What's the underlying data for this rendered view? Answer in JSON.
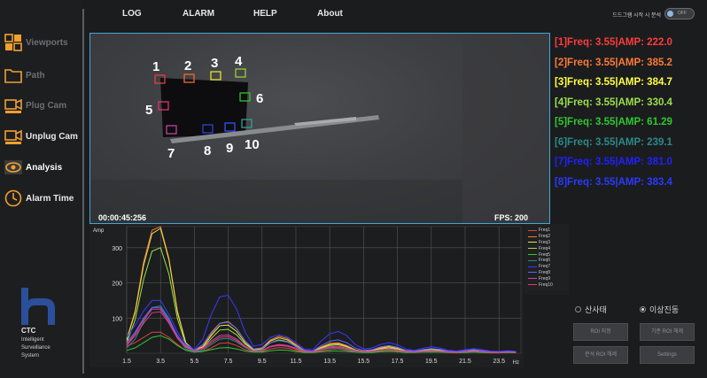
{
  "sidebar": {
    "items": [
      {
        "label": "Viewports",
        "color": "#f0a030"
      },
      {
        "label": "Path",
        "color": "#f0a030"
      },
      {
        "label": "Plug Cam",
        "color": "#f0a030"
      },
      {
        "label": "Unplug Cam",
        "color": "#f0a030"
      },
      {
        "label": "Analysis",
        "color": "#f0a030"
      },
      {
        "label": "Alarm Time",
        "color": "#f0a030"
      }
    ],
    "logo": {
      "name": "CTC",
      "tagline": [
        "Intelligent",
        "Surveillance",
        "System"
      ],
      "color": "#2b4f9a"
    }
  },
  "menu": {
    "items": [
      "LOG",
      "ALARM",
      "HELP",
      "About"
    ],
    "toggle_label": "드드그램 시작 시 분석",
    "toggle_state": "OFF"
  },
  "video": {
    "timecode": "00:00:45:256",
    "fps": "FPS: 200",
    "rois": [
      {
        "label": "1",
        "color": "#e04040"
      },
      {
        "label": "2",
        "color": "#f06a30"
      },
      {
        "label": "3",
        "color": "#e8e030"
      },
      {
        "label": "4",
        "color": "#8ed03a"
      },
      {
        "label": "5",
        "color": "#e03070"
      },
      {
        "label": "6",
        "color": "#30c030"
      },
      {
        "label": "7",
        "color": "#c040a0"
      },
      {
        "label": "8",
        "color": "#3040d0"
      },
      {
        "label": "9",
        "color": "#3050ff"
      },
      {
        "label": "10",
        "color": "#30a090"
      }
    ]
  },
  "readouts": [
    {
      "text": "[1]Freq: 3.55|AMP: 222.0",
      "color": "#ff3b3b"
    },
    {
      "text": "[2]Freq: 3.55|AMP: 385.2",
      "color": "#ff7a3a"
    },
    {
      "text": "[3]Freq: 3.55|AMP: 384.7",
      "color": "#ffff40"
    },
    {
      "text": "[4]Freq: 3.55|AMP: 330.4",
      "color": "#9be04a"
    },
    {
      "text": "[5]Freq: 3.55|AMP: 61.29",
      "color": "#2fc82f"
    },
    {
      "text": "[6]Freq: 3.55|AMP: 239.1",
      "color": "#2a8a8a"
    },
    {
      "text": "[7]Freq: 3.55|AMP: 381.0",
      "color": "#2020ff"
    },
    {
      "text": "[8]Freq: 3.55|AMP: 383.4",
      "color": "#2a3aff"
    }
  ],
  "chart_data": {
    "type": "line",
    "ylabel": "Amp",
    "xlabel": "Hz",
    "xlim": [
      1.5,
      24.8
    ],
    "ylim": [
      0,
      360
    ],
    "x_ticks": [
      "1.5",
      "3.5",
      "5.5",
      "7.5",
      "9.5",
      "11.5",
      "13.5",
      "15.5",
      "17.5",
      "19.5",
      "21.5",
      "23.5"
    ],
    "x_tick_values": [
      1.5,
      3.5,
      5.5,
      7.5,
      9.5,
      11.5,
      13.5,
      15.5,
      17.5,
      19.5,
      21.5,
      23.5
    ],
    "y_ticks": [
      "100",
      "200",
      "300"
    ],
    "y_tick_values": [
      100,
      200,
      300
    ],
    "x": [
      1.5,
      2.0,
      2.5,
      3.0,
      3.5,
      4.0,
      4.5,
      5.0,
      5.5,
      6.0,
      6.5,
      7.0,
      7.5,
      8.0,
      8.5,
      9.0,
      9.5,
      10.0,
      10.5,
      11.0,
      11.5,
      12.0,
      12.5,
      13.0,
      13.5,
      14.0,
      14.5,
      15.0,
      15.5,
      16.0,
      16.5,
      17.0,
      17.5,
      18.0,
      18.5,
      19.0,
      19.5,
      20.0,
      20.5,
      21.0,
      21.5,
      22.0,
      22.5,
      23.0,
      23.5,
      24.0,
      24.5
    ],
    "series": [
      {
        "name": "Freq1",
        "color": "#e04040",
        "values": [
          20,
          30,
          45,
          60,
          60,
          45,
          25,
          8,
          3,
          5,
          15,
          28,
          30,
          22,
          10,
          4,
          5,
          12,
          16,
          14,
          8,
          3,
          2,
          6,
          10,
          12,
          8,
          4,
          2,
          3,
          6,
          8,
          6,
          3,
          2,
          4,
          5,
          4,
          2,
          2,
          3,
          4,
          3,
          2,
          2,
          3,
          2
        ]
      },
      {
        "name": "Freq2",
        "color": "#f07a3a",
        "values": [
          40,
          120,
          260,
          350,
          360,
          270,
          120,
          30,
          8,
          20,
          55,
          85,
          90,
          70,
          35,
          12,
          15,
          38,
          48,
          42,
          25,
          8,
          6,
          18,
          28,
          30,
          22,
          10,
          5,
          8,
          16,
          20,
          15,
          7,
          5,
          9,
          12,
          10,
          5,
          4,
          7,
          9,
          7,
          4,
          3,
          5,
          4
        ]
      },
      {
        "name": "Freq3",
        "color": "#e8e048",
        "values": [
          38,
          115,
          250,
          340,
          355,
          265,
          115,
          28,
          8,
          18,
          50,
          78,
          80,
          62,
          30,
          10,
          14,
          35,
          44,
          38,
          22,
          7,
          5,
          16,
          25,
          27,
          20,
          9,
          5,
          7,
          14,
          18,
          13,
          6,
          4,
          8,
          11,
          9,
          5,
          4,
          6,
          8,
          6,
          4,
          3,
          4,
          3
        ]
      },
      {
        "name": "Freq4",
        "color": "#9be04a",
        "values": [
          30,
          95,
          210,
          290,
          300,
          225,
          98,
          24,
          7,
          15,
          42,
          66,
          68,
          52,
          26,
          9,
          12,
          30,
          38,
          33,
          19,
          6,
          5,
          14,
          22,
          24,
          18,
          8,
          4,
          6,
          12,
          15,
          11,
          5,
          4,
          7,
          9,
          8,
          4,
          3,
          5,
          7,
          5,
          3,
          3,
          4,
          3
        ]
      },
      {
        "name": "Freq5",
        "color": "#2fc82f",
        "values": [
          8,
          15,
          30,
          45,
          50,
          40,
          22,
          8,
          3,
          5,
          10,
          15,
          16,
          12,
          6,
          3,
          3,
          7,
          9,
          8,
          5,
          2,
          2,
          4,
          6,
          6,
          5,
          3,
          2,
          2,
          4,
          5,
          4,
          2,
          2,
          3,
          3,
          3,
          2,
          1,
          2,
          3,
          2,
          1,
          1,
          2,
          1
        ]
      },
      {
        "name": "Freq6",
        "color": "#2a8a8a",
        "values": [
          15,
          40,
          90,
          130,
          135,
          100,
          45,
          12,
          4,
          8,
          25,
          40,
          42,
          32,
          16,
          5,
          7,
          18,
          22,
          20,
          12,
          4,
          3,
          9,
          14,
          15,
          11,
          5,
          3,
          4,
          8,
          10,
          8,
          4,
          3,
          5,
          6,
          5,
          3,
          2,
          4,
          5,
          4,
          2,
          2,
          3,
          2
        ]
      },
      {
        "name": "Freq7",
        "color": "#3a3aff",
        "values": [
          45,
          80,
          120,
          150,
          150,
          110,
          60,
          25,
          10,
          40,
          110,
          160,
          165,
          125,
          60,
          20,
          25,
          45,
          52,
          46,
          30,
          12,
          10,
          35,
          55,
          62,
          50,
          25,
          12,
          15,
          25,
          30,
          24,
          12,
          8,
          14,
          18,
          15,
          8,
          6,
          10,
          13,
          10,
          6,
          5,
          7,
          5
        ]
      },
      {
        "name": "Freq8",
        "color": "#5a6aff",
        "values": [
          30,
          60,
          100,
          130,
          130,
          95,
          50,
          20,
          8,
          25,
          60,
          85,
          88,
          70,
          35,
          12,
          15,
          30,
          36,
          32,
          20,
          8,
          6,
          22,
          34,
          38,
          30,
          15,
          8,
          10,
          18,
          22,
          17,
          8,
          6,
          10,
          13,
          11,
          6,
          4,
          7,
          10,
          7,
          4,
          3,
          5,
          4
        ]
      },
      {
        "name": "Freq9",
        "color": "#d040a0",
        "values": [
          25,
          55,
          95,
          125,
          125,
          90,
          45,
          18,
          7,
          15,
          35,
          50,
          52,
          40,
          20,
          7,
          9,
          20,
          25,
          22,
          14,
          5,
          4,
          12,
          18,
          20,
          15,
          8,
          4,
          6,
          10,
          12,
          9,
          5,
          3,
          6,
          8,
          6,
          4,
          3,
          4,
          6,
          4,
          3,
          2,
          3,
          2
        ]
      },
      {
        "name": "Freq10",
        "color": "#e03a7a",
        "values": [
          22,
          50,
          85,
          115,
          118,
          85,
          42,
          16,
          6,
          12,
          30,
          45,
          47,
          36,
          18,
          6,
          8,
          18,
          22,
          20,
          12,
          4,
          3,
          10,
          16,
          17,
          13,
          7,
          4,
          5,
          9,
          11,
          8,
          4,
          3,
          5,
          7,
          5,
          3,
          2,
          4,
          5,
          4,
          2,
          2,
          3,
          2
        ]
      }
    ]
  },
  "controls": {
    "radio_left": "산사태",
    "radio_right": "이상진동",
    "selected": "이상진동",
    "buttons": [
      "ROI 지정",
      "기준 ROI 해제",
      "분석 ROI 해제",
      "Settings"
    ]
  }
}
